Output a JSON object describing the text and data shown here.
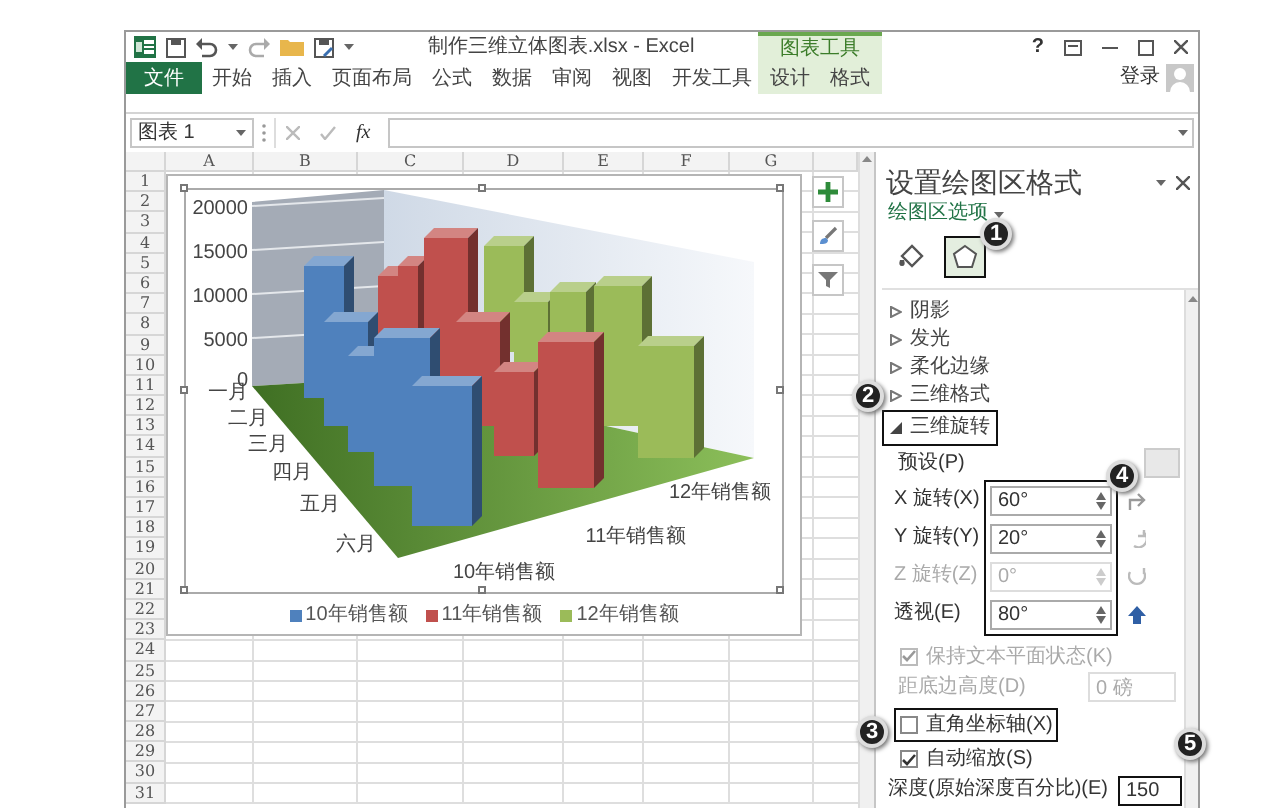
{
  "window": {
    "title": "制作三维立体图表.xlsx - Excel",
    "context_group": "图表工具",
    "help": "?"
  },
  "ribbon_tabs": [
    {
      "label": "文件",
      "kind": "file",
      "selected": false
    },
    {
      "label": "开始",
      "kind": "main",
      "selected": false
    },
    {
      "label": "插入",
      "kind": "main",
      "selected": false
    },
    {
      "label": "页面布局",
      "kind": "main",
      "selected": false
    },
    {
      "label": "公式",
      "kind": "main",
      "selected": false
    },
    {
      "label": "数据",
      "kind": "main",
      "selected": false
    },
    {
      "label": "审阅",
      "kind": "main",
      "selected": false
    },
    {
      "label": "视图",
      "kind": "main",
      "selected": false
    },
    {
      "label": "开发工具",
      "kind": "main",
      "selected": false
    },
    {
      "label": "设计",
      "kind": "context",
      "selected": false
    },
    {
      "label": "格式",
      "kind": "context",
      "selected": false
    }
  ],
  "account": {
    "label": "登录"
  },
  "formula_bar": {
    "name_box": "图表 1",
    "fx": "fx"
  },
  "sheet": {
    "columns": [
      "A",
      "B",
      "C",
      "D",
      "E",
      "F",
      "G"
    ],
    "rows": [
      "1",
      "2",
      "3",
      "4",
      "5",
      "6",
      "7",
      "8",
      "9",
      "10",
      "11",
      "12",
      "13",
      "14",
      "15",
      "16",
      "17",
      "18",
      "19",
      "20",
      "21",
      "22",
      "23",
      "24",
      "25",
      "26",
      "27",
      "28",
      "29",
      "30",
      "31"
    ]
  },
  "chart": {
    "y_ticks": [
      "20000",
      "15000",
      "10000",
      "5000",
      "0"
    ],
    "categories": [
      "一月",
      "二月",
      "三月",
      "四月",
      "五月",
      "六月"
    ],
    "series_axis": [
      "10年销售额",
      "11年销售额",
      "12年销售额"
    ],
    "legend": [
      {
        "label": "10年销售额",
        "color": "#4f81bd"
      },
      {
        "label": "11年销售额",
        "color": "#c0504d"
      },
      {
        "label": "12年销售额",
        "color": "#9bbb59"
      }
    ]
  },
  "format_panel": {
    "title": "设置绘图区格式",
    "options_label": "绘图区选项",
    "tabs": [
      {
        "kind": "fill",
        "selected": false,
        "highlighted": false
      },
      {
        "kind": "effects",
        "selected": true,
        "highlighted": true
      }
    ],
    "sections": [
      {
        "label": "阴影",
        "expanded": false,
        "highlighted": false
      },
      {
        "label": "发光",
        "expanded": false,
        "highlighted": false
      },
      {
        "label": "柔化边缘",
        "expanded": false,
        "highlighted": false
      },
      {
        "label": "三维格式",
        "expanded": false,
        "highlighted": false
      },
      {
        "label": "三维旋转",
        "expanded": true,
        "highlighted": true
      }
    ],
    "preset_label": "预设(P)",
    "rotation": {
      "highlighted": true,
      "fields": [
        {
          "label": "X 旋转(X)",
          "value": "60°",
          "disabled": false
        },
        {
          "label": "Y 旋转(Y)",
          "value": "20°",
          "disabled": false
        },
        {
          "label": "Z 旋转(Z)",
          "value": "0°",
          "disabled": true
        },
        {
          "label": "透视(E)",
          "value": "80°",
          "disabled": false
        }
      ]
    },
    "keep_text_flat": {
      "label": "保持文本平面状态(K)",
      "checked": true,
      "disabled": true
    },
    "distance": {
      "label": "距底边高度(D)",
      "value": "0 磅",
      "disabled": true
    },
    "right_angle_axes": {
      "label": "直角坐标轴(X)",
      "checked": false,
      "highlighted": true
    },
    "autoscale": {
      "label": "自动缩放(S)",
      "checked": true
    },
    "depth": {
      "label": "深度(原始深度百分比)(E)",
      "value": "150",
      "highlighted": true
    }
  },
  "callouts": [
    "1",
    "2",
    "3",
    "4",
    "5"
  ]
}
